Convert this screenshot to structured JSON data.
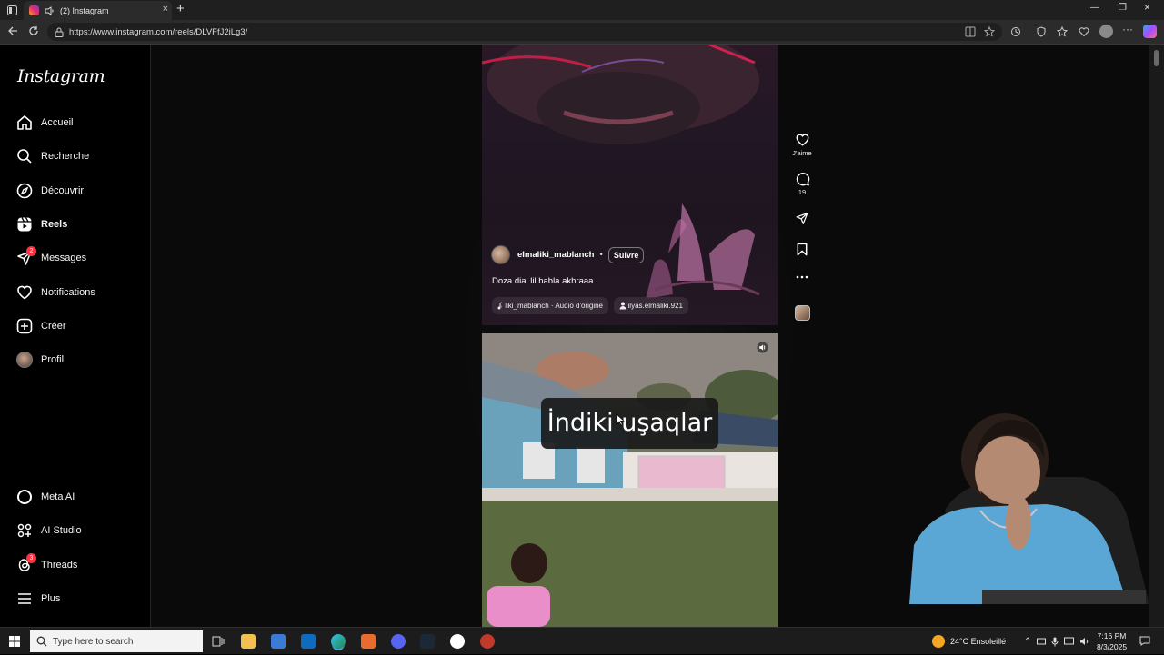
{
  "browser": {
    "tab": {
      "title": "(2) Instagram"
    },
    "url": "https://www.instagram.com/reels/DLVFfJ2iLg3/"
  },
  "sidebar": {
    "logo": "Instagram",
    "items": [
      {
        "label": "Accueil",
        "icon": "home-icon"
      },
      {
        "label": "Recherche",
        "icon": "search-icon"
      },
      {
        "label": "Découvrir",
        "icon": "compass-icon"
      },
      {
        "label": "Reels",
        "icon": "reels-icon",
        "active": true
      },
      {
        "label": "Messages",
        "icon": "messages-icon",
        "badge": "2"
      },
      {
        "label": "Notifications",
        "icon": "heart-icon"
      },
      {
        "label": "Créer",
        "icon": "plus-square-icon"
      },
      {
        "label": "Profil",
        "icon": "avatar"
      }
    ],
    "bottom_items": [
      {
        "label": "Meta AI",
        "icon": "meta-ai-icon"
      },
      {
        "label": "AI Studio",
        "icon": "ai-studio-icon"
      },
      {
        "label": "Threads",
        "icon": "threads-icon",
        "badge": "3"
      },
      {
        "label": "Plus",
        "icon": "menu-icon"
      }
    ]
  },
  "reel": {
    "username": "elmaliki_mablanch",
    "separator": "•",
    "follow_label": "Suivre",
    "caption": "Doza dial lil habla akhraaa",
    "audio": "liki_mablanch · Audio d'origine",
    "tagged_user": "ilyas.elmaliki.921",
    "actions": {
      "like_label": "J'aime",
      "comments_count": "19"
    }
  },
  "next_reel": {
    "overlay_text": "İndiki uşaqlar"
  },
  "taskbar": {
    "search_placeholder": "Type here to search",
    "weather": "24°C  Ensoleillé",
    "time": "7:16 PM",
    "date": "8/3/2025"
  },
  "colors": {
    "accent_badge": "#ff3040",
    "background": "#000000"
  }
}
